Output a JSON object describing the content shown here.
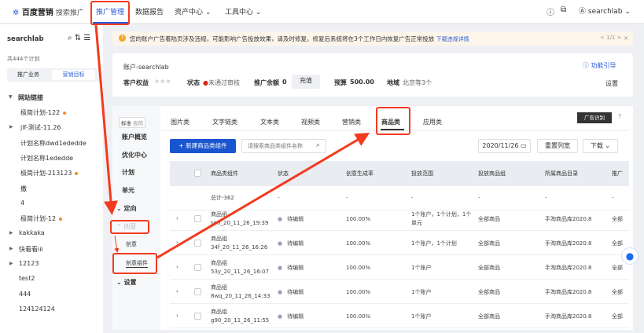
{
  "header": {
    "logo": "百度营销",
    "logo_sub": "搜索推广",
    "nav": [
      "推广管理",
      "数据报告",
      "资产中心",
      "工具中心"
    ],
    "user": "searchlab"
  },
  "sidebar": {
    "account": "searchlab",
    "count": "共444个计划",
    "tabs": [
      "推广业务",
      "营销目标"
    ],
    "group": "网站链接",
    "items": [
      {
        "label": "极简计划-122",
        "dot": true
      },
      {
        "label": "jlf-测试-11.26",
        "arrow": true
      },
      {
        "label": "计划名称dwd1ededde"
      },
      {
        "label": "计划名称1ededde"
      },
      {
        "label": "极简计划-213123",
        "dot": true
      },
      {
        "label": "撒"
      },
      {
        "label": "4"
      },
      {
        "label": "极简计划-12",
        "dot": true
      },
      {
        "label": "kakkaka",
        "arrow": true,
        "top": true
      },
      {
        "label": "快看看iii",
        "arrow": true,
        "top": true
      },
      {
        "label": "12123",
        "arrow": true,
        "top": true
      },
      {
        "label": "test2",
        "top": true
      },
      {
        "label": "444",
        "top": true
      },
      {
        "label": "124124124",
        "top": true
      }
    ]
  },
  "notice": {
    "text": "您的账户广告着陆页涉及违规，可能影响广告投放效果，请及时修复。修复后系统将在3个工作日内恢复广告正常投放",
    "link": "下载违规详情",
    "pager": "< 1/1 >"
  },
  "account": {
    "title": "账户-searchlab",
    "rights_label": "客户权益",
    "status_label": "状态",
    "status": "未通过审核",
    "balance_label": "推广余额",
    "balance": "0",
    "recharge": "充值",
    "budget_label": "预算",
    "budget": "500.00",
    "region_label": "地域",
    "region": "北京等3个",
    "guide": "功能引导",
    "settings": "设置"
  },
  "leftnav": {
    "mode": [
      "标准",
      "极简"
    ],
    "items": [
      "账户概览",
      "优化中心",
      "计划",
      "单元",
      "定向",
      "创意",
      "创意",
      "创意组件",
      "设置"
    ]
  },
  "tabs": [
    "图片类",
    "文字链类",
    "文本类",
    "视频类",
    "营销类",
    "商品类",
    "应用类"
  ],
  "ad_recog": "广告识别",
  "toolbar": {
    "new": "+ 新建商品类组件",
    "search_placeholder": "请搜索商品类组件名称",
    "date": "2020/11/26",
    "reset": "重置列宽",
    "download": "下载"
  },
  "table": {
    "headers": [
      "商品类组件",
      "状态",
      "创意生成率",
      "投放范围",
      "投放商品组",
      "所属商品目录",
      "推广"
    ],
    "total": [
      "总计-362",
      "-",
      "-",
      "-",
      "-",
      "-",
      "-"
    ],
    "rows": [
      [
        "商品组sph_20_11_26_19:39",
        "待编辑",
        "100.00%",
        "1个账户，1个计划，1个单元",
        "全部商品",
        "手淘商品库2020.8",
        "全部"
      ],
      [
        "商品组34f_20_11_26_16:26",
        "待编辑",
        "100.00%",
        "1个账户，1个计划",
        "全部商品",
        "手淘商品库2020.8",
        "全部"
      ],
      [
        "商品组53y_20_11_26_16:07",
        "待编辑",
        "100.00%",
        "1个账户",
        "全部商品",
        "手淘商品库2020.8",
        "全部"
      ],
      [
        "商品组8wq_20_11_26_14:33",
        "待编辑",
        "100.00%",
        "1个账户",
        "全部商品",
        "手淘商品库2020.8",
        "全部"
      ],
      [
        "商品组g90_20_11_26_11:55",
        "待编辑",
        "100.00%",
        "1个账户",
        "全部商品",
        "手淘商品库2020.8",
        "全部"
      ]
    ]
  },
  "colors": {
    "accent": "#2a5bd7",
    "annotation": "#f23b1f"
  }
}
